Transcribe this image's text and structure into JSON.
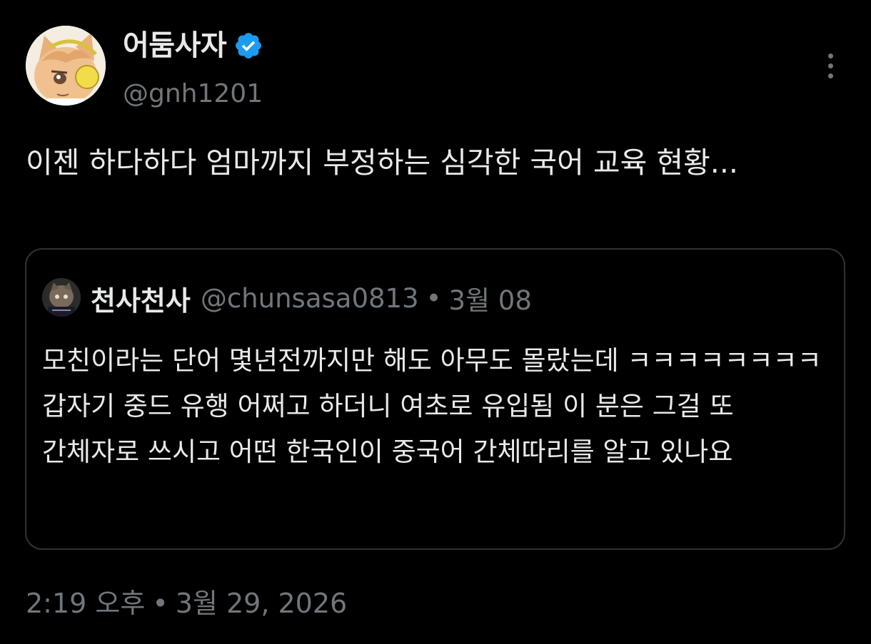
{
  "author": {
    "display_name": "어둠사자",
    "handle": "@gnh1201",
    "verified": true,
    "badge_color": "#1d9bf0"
  },
  "tweet": {
    "text": "이젠 하다하다 엄마까지 부정하는 심각한 국어 교육 현황..."
  },
  "quote": {
    "display_name": "천사천사",
    "handle": "@chunsasa0813",
    "separator": "•",
    "date": "3월 08",
    "text": "모친이라는 단어 몇년전까지만 해도 아무도 몰랐는데 ㅋㅋㅋㅋㅋㅋㅋㅋ 갑자기 중드 유행 어쩌고 하더니 여초로 유입됨 이 분은 그걸 또 간체자로 쓰시고 어떤 한국인이 중국어 간체따리를 알고 있나요"
  },
  "footer": {
    "time": "2:19 오후",
    "separator": "•",
    "date": "3월 29, 2026"
  },
  "icons": {
    "more": "more-vertical-icon",
    "verified": "verified-badge-icon"
  },
  "colors": {
    "background": "#000000",
    "text_primary": "#e7e9ea",
    "text_secondary": "#71767b",
    "border": "#2f3336"
  }
}
